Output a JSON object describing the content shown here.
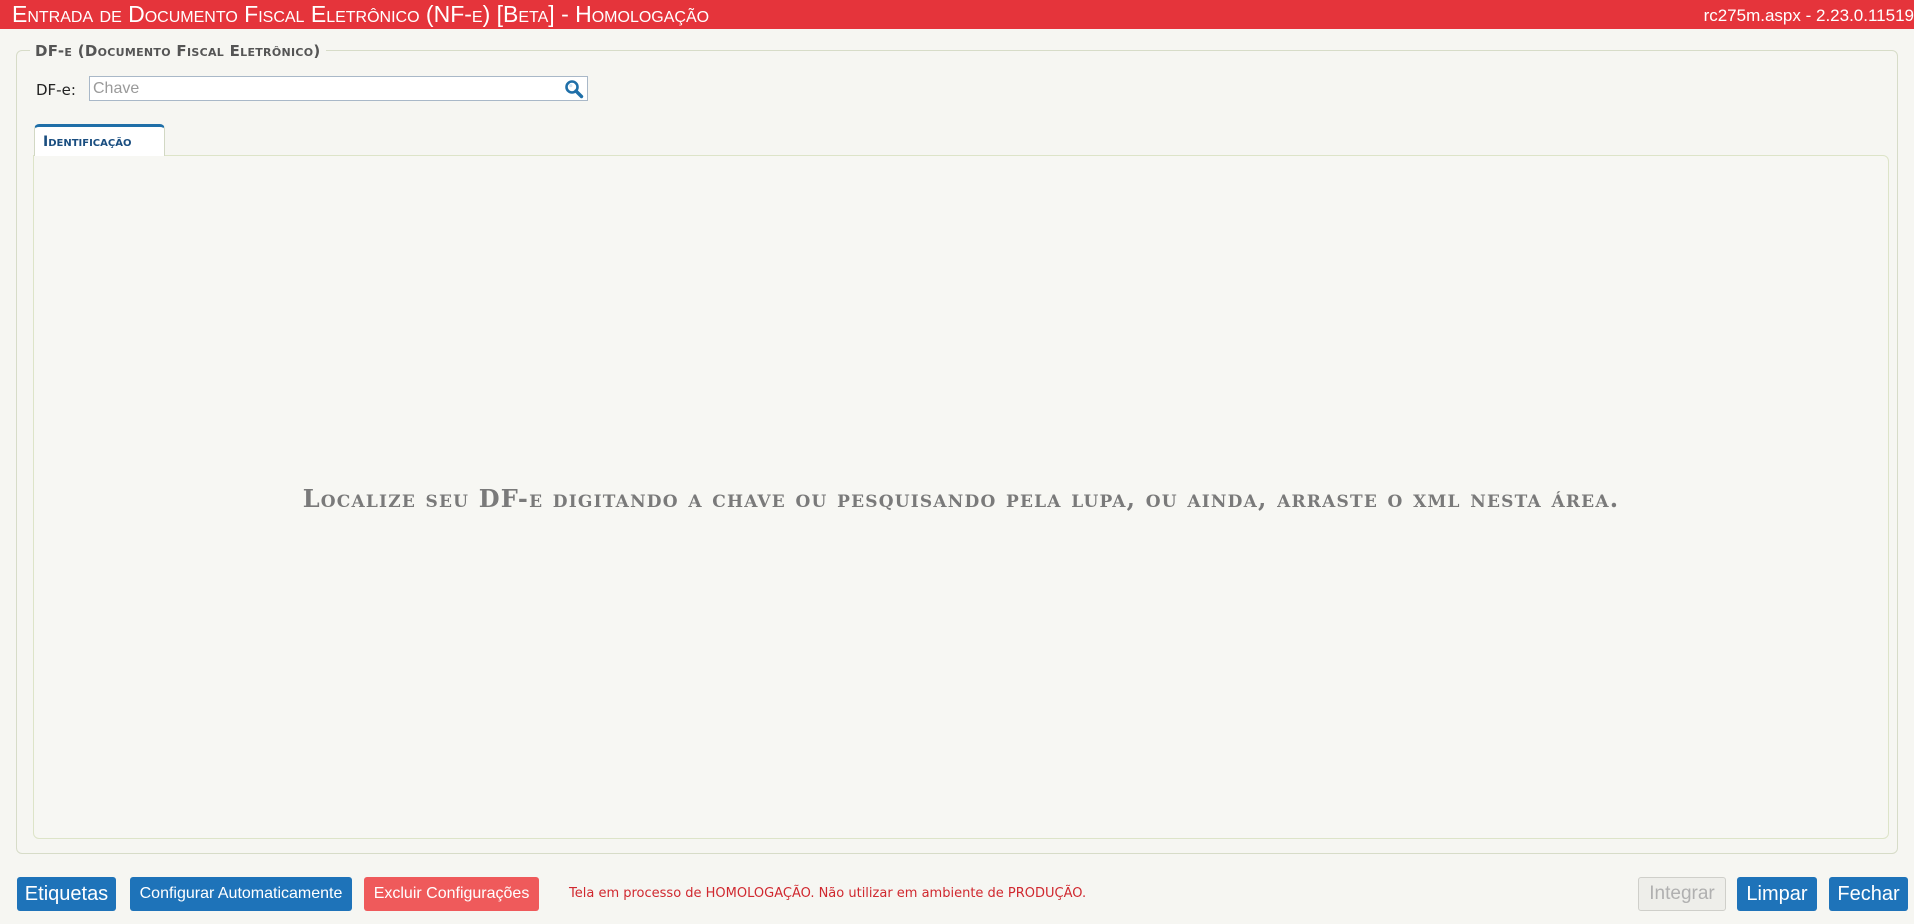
{
  "window": {
    "title": "Entrada de Documento Fiscal Eletrônico (NF-e) [Beta]  - Homologação",
    "version": "rc275m.aspx - 2.23.0.11519"
  },
  "section": {
    "legend": "DF-e (Documento Fiscal Eletrônico)"
  },
  "search": {
    "label": "DF-e:",
    "placeholder": "Chave",
    "value": ""
  },
  "tabs": [
    {
      "label": "Identificação",
      "active": true
    }
  ],
  "main": {
    "drop_message": "Localize seu DF-e digitando a chave ou pesquisando pela lupa, ou ainda, arraste o xml nesta área."
  },
  "footer": {
    "etiquetas_label": "Etiquetas",
    "configurar_label": "Configurar Automaticamente",
    "excluir_label": "Excluir Configurações",
    "warning": "Tela em processo de HOMOLOGAÇÃO. Não utilizar em ambiente de PRODUÇÃO.",
    "integrar_label": "Integrar",
    "limpar_label": "Limpar",
    "fechar_label": "Fechar"
  },
  "colors": {
    "titlebar": "#e5343b",
    "primary_button": "#1e73b9",
    "danger_button": "#ef5a5b",
    "warning_text": "#d0282f"
  },
  "icons": {
    "search": "search-icon"
  }
}
